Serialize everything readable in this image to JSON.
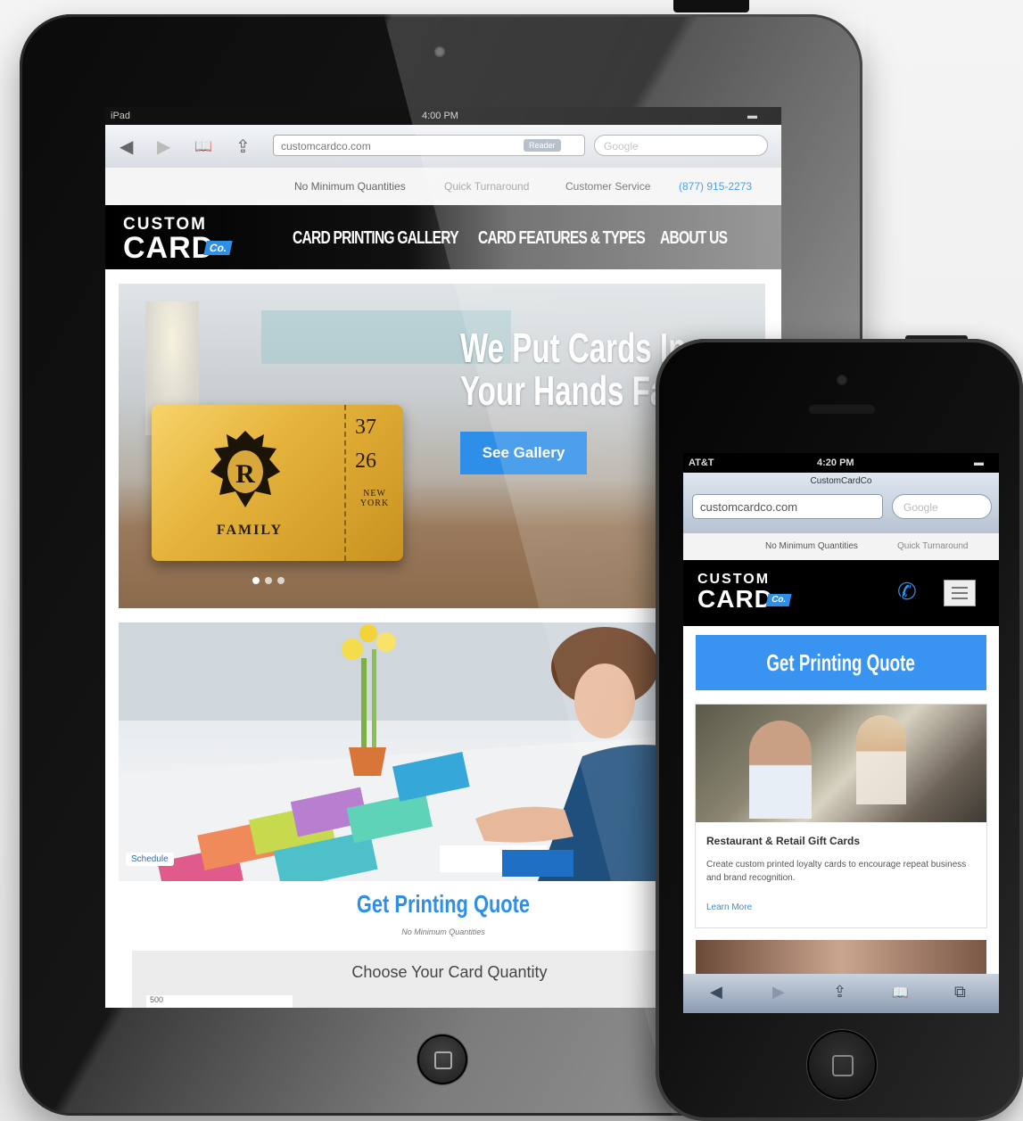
{
  "ipad": {
    "status": {
      "carrier": "iPad",
      "time": "4:00 PM",
      "battery": "▬"
    },
    "browser": {
      "back_icon": "◀",
      "forward_icon": "▶",
      "bookmarks_icon": "📖",
      "share_icon": "⇪",
      "url": "customcardco.com",
      "reader_badge": "Reader",
      "search_placeholder": "Google"
    },
    "site": {
      "top_info": {
        "no_minimum": "No Minimum Quantities",
        "turnaround": "Quick Turnaround",
        "service": "Customer Service",
        "phone": "(877) 915-2273"
      },
      "logo": {
        "line1": "CUSTOM",
        "line2": "CARD",
        "suffix": "Co."
      },
      "nav": [
        "CARD PRINTING GALLERY",
        "CARD FEATURES & TYPES",
        "ABOUT US"
      ],
      "hero": {
        "title_line1": "We Put Cards In",
        "title_line2": "Your Hands Fast",
        "button": "See Gallery",
        "card": {
          "num1": "37",
          "num2": "26",
          "stub_text": "NEW YORK",
          "family": "FAMILY"
        }
      },
      "schedule_badge": "Schedule",
      "quote": {
        "title": "Get Printing Quote",
        "subtitle": "No Minimum Quantities",
        "quantity_label": "Choose Your Card Quantity",
        "quantity_value": "500"
      }
    }
  },
  "iphone": {
    "status": {
      "carrier": "AT&T",
      "time": "4:20 PM",
      "battery": "▬"
    },
    "browser": {
      "page_title": "CustomCardCo",
      "url": "customcardco.com",
      "search_placeholder": "Google"
    },
    "site": {
      "top_info": {
        "no_minimum": "No Minimum Quantities",
        "turnaround": "Quick Turnaround"
      },
      "logo": {
        "line1": "CUSTOM",
        "line2": "CARD",
        "suffix": "Co."
      },
      "quote_button": "Get Printing Quote",
      "card": {
        "title": "Restaurant & Retail Gift Cards",
        "body": "Create custom printed loyalty cards to encourage repeat business and brand recognition.",
        "link": "Learn More"
      }
    },
    "toolbar": {
      "back_icon": "◀",
      "forward_icon": "▶",
      "share_icon": "⇪",
      "bookmarks_icon": "📖",
      "tabs_icon": "⧉"
    }
  },
  "colors": {
    "accent": "#2e8fe8",
    "gold": "#e5b33b",
    "device": "#111111"
  }
}
